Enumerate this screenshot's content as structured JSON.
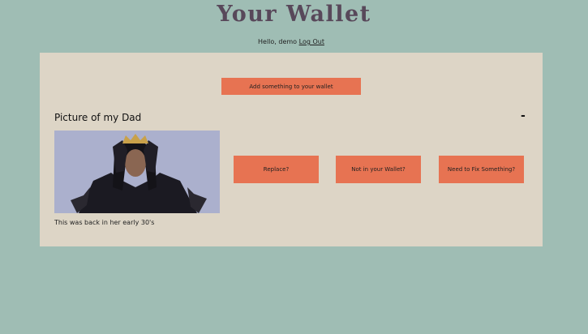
{
  "header": {
    "title": "Your Wallet",
    "greeting": "Hello, demo",
    "logout_label": "Log Out"
  },
  "wallet": {
    "add_label": "Add something to your wallet",
    "items": [
      {
        "title": "Picture of my Dad",
        "collapse_label": "-",
        "caption": "This was back in her early 30's",
        "actions": [
          "Replace?",
          "Not in your Wallet?",
          "Need to Fix Something?"
        ]
      }
    ]
  },
  "colors": {
    "background": "#9fbdb4",
    "panel": "#ddd5c6",
    "accent_button": "#e77352",
    "title": "#58485a"
  }
}
